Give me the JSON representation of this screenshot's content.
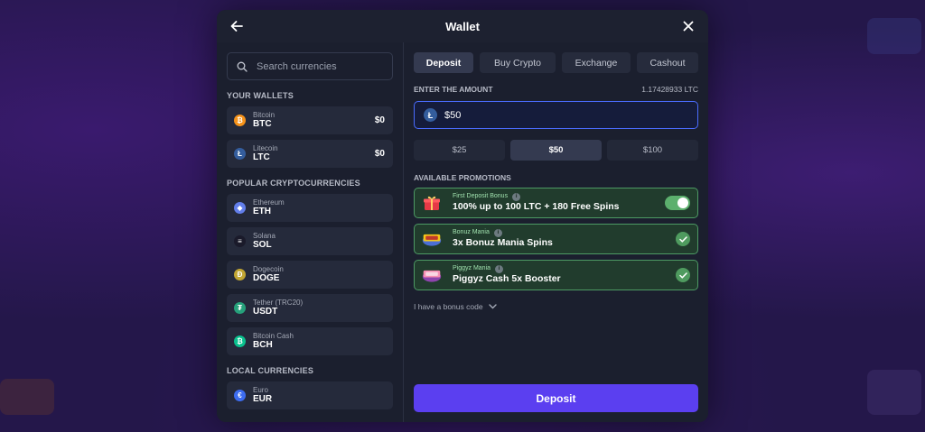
{
  "colors": {
    "accent": "#5b3ff0",
    "modal_bg": "#1b1f2e",
    "promo_green": "#4d9a64",
    "input_focus": "#4a6cff"
  },
  "header": {
    "title": "Wallet",
    "back_icon": "arrow-left-icon",
    "close_icon": "close-icon"
  },
  "search": {
    "placeholder": "Search currencies"
  },
  "sections": {
    "your_wallets": "YOUR WALLETS",
    "popular": "POPULAR CRYPTOCURRENCIES",
    "local": "LOCAL CURRENCIES"
  },
  "wallets": [
    {
      "name": "Bitcoin",
      "symbol": "BTC",
      "balance": "$0",
      "color": "#f7931a",
      "glyph": "₿"
    },
    {
      "name": "Litecoin",
      "symbol": "LTC",
      "balance": "$0",
      "color": "#345d9d",
      "glyph": "Ł"
    }
  ],
  "popular": [
    {
      "name": "Ethereum",
      "symbol": "ETH",
      "color": "#627eea",
      "glyph": "◆"
    },
    {
      "name": "Solana",
      "symbol": "SOL",
      "color": "#1a1a2a",
      "glyph": "≡"
    },
    {
      "name": "Dogecoin",
      "symbol": "DOGE",
      "color": "#c2a633",
      "glyph": "Ð"
    },
    {
      "name": "Tether (TRC20)",
      "symbol": "USDT",
      "color": "#26a17b",
      "glyph": "₮"
    },
    {
      "name": "Bitcoin Cash",
      "symbol": "BCH",
      "color": "#0ac18e",
      "glyph": "₿"
    }
  ],
  "local": [
    {
      "name": "Euro",
      "symbol": "EUR",
      "color": "#3d6cf0",
      "glyph": "€"
    }
  ],
  "tabs": [
    {
      "label": "Deposit",
      "active": true
    },
    {
      "label": "Buy Crypto",
      "active": false
    },
    {
      "label": "Exchange",
      "active": false
    },
    {
      "label": "Cashout",
      "active": false
    }
  ],
  "amount": {
    "label": "ENTER THE AMOUNT",
    "crypto_equivalent": "1.17428933 LTC",
    "value": "$50",
    "presets": [
      {
        "label": "$25",
        "active": false
      },
      {
        "label": "$50",
        "active": true
      },
      {
        "label": "$100",
        "active": false
      }
    ]
  },
  "promotions": {
    "label": "AVAILABLE PROMOTIONS",
    "items": [
      {
        "title": "First Deposit Bonus",
        "desc": "100% up to 100 LTC + 180 Free Spins",
        "control": "toggle",
        "icon": "gift-icon"
      },
      {
        "title": "Bonuz Mania",
        "desc": "3x Bonuz Mania Spins",
        "control": "check",
        "icon": "bonuz-mania-logo-icon"
      },
      {
        "title": "Piggyz Mania",
        "desc": "Piggyz Cash 5x Booster",
        "control": "check",
        "icon": "piggyz-mania-logo-icon"
      }
    ],
    "bonus_code": "I have a bonus code"
  },
  "deposit_button": "Deposit"
}
